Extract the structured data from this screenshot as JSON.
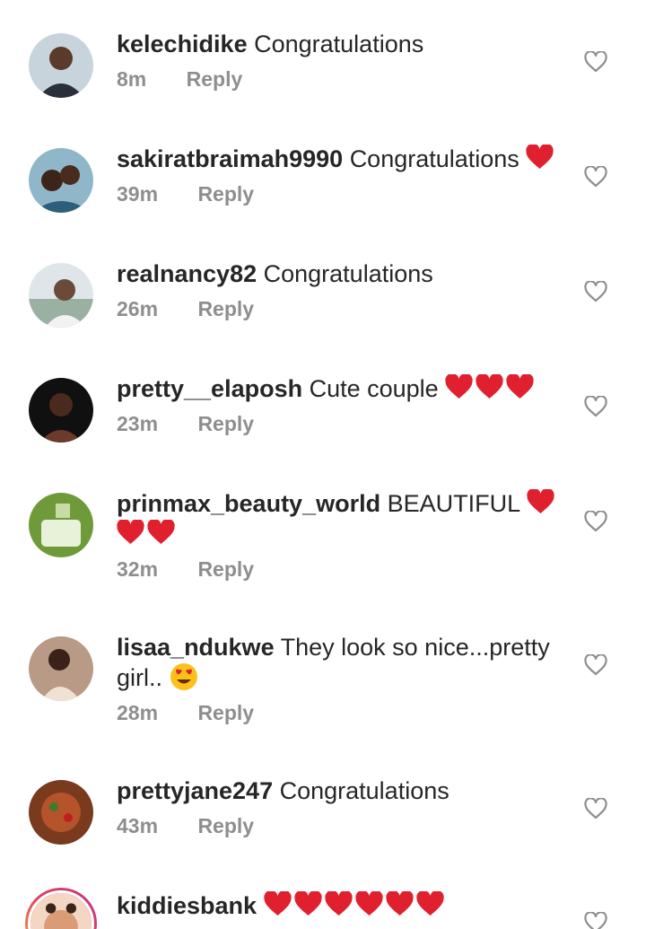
{
  "comments": [
    {
      "username": "kelechidike",
      "text": "Congratulations",
      "hearts": 0,
      "time": "8m",
      "reply": "Reply"
    },
    {
      "username": "sakiratbraimah9990",
      "text": "Congratulations",
      "hearts": 1,
      "time": "39m",
      "reply": "Reply"
    },
    {
      "username": "realnancy82",
      "text": "Congratulations",
      "hearts": 0,
      "time": "26m",
      "reply": "Reply"
    },
    {
      "username": "pretty__elaposh",
      "text": "Cute couple",
      "hearts": 3,
      "time": "23m",
      "reply": "Reply"
    },
    {
      "username": "prinmax_beauty_world",
      "text": "BEAUTIFUL",
      "hearts": 3,
      "time": "32m",
      "reply": "Reply"
    },
    {
      "username": "lisaa_ndukwe",
      "text": "They look so nice...pretty girl..",
      "emoji": "heart-eyes",
      "time": "28m",
      "reply": "Reply"
    },
    {
      "username": "prettyjane247",
      "text": "Congratulations",
      "hearts": 0,
      "time": "43m",
      "reply": "Reply"
    },
    {
      "username": "kiddiesbank",
      "text": "",
      "hearts": 6,
      "time": "",
      "reply": ""
    }
  ],
  "icons": {
    "like": "heart-outline-icon",
    "emoji_heart": "red-heart-emoji",
    "emoji_love": "heart-eyes-emoji"
  },
  "colors": {
    "username": "#262626",
    "meta": "#8e8e8e",
    "heart": "#e0202e",
    "like_outline": "#8e8e8e"
  }
}
